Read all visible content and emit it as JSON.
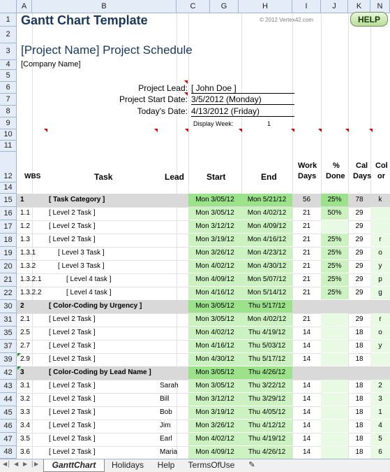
{
  "app": {
    "title": "Gantt Chart Template",
    "copyright": "© 2012 Vertex42.com",
    "help_label": "HELP"
  },
  "columns": [
    "A",
    "B",
    "C",
    "G",
    "H",
    "I",
    "J",
    "K",
    "N"
  ],
  "row_numbers": [
    "1",
    "2",
    "3",
    "4",
    "5",
    "6",
    "7",
    "8",
    "9",
    "10",
    "11",
    "12",
    "14",
    "15",
    "16",
    "17",
    "18",
    "19",
    "20",
    "21",
    "22",
    "30",
    "31",
    "35",
    "37",
    "39",
    "42",
    "43",
    "44",
    "45",
    "46",
    "47",
    "48"
  ],
  "project": {
    "name": "[Project Name] Project Schedule",
    "company": "[Company Name]",
    "lead_label": "Project Lead:",
    "lead_value": "[ John Doe ]",
    "start_label": "Project Start Date:",
    "start_value": "3/5/2012 (Monday)",
    "today_label": "Today's Date:",
    "today_value": "4/13/2012 (Friday)",
    "week_label": "Display Week:",
    "week_value": "1"
  },
  "headers": {
    "wbs": "WBS",
    "task": "Task",
    "lead": "Lead",
    "start": "Start",
    "end": "End",
    "work_days_1": "Work",
    "work_days_2": "Days",
    "done_1": "%",
    "done_2": "Done",
    "cal_days_1": "Cal",
    "cal_days_2": "Days",
    "color_1": "Col",
    "color_2": "or"
  },
  "tasks": [
    {
      "wbs": "1",
      "task": "[ Task Category ]",
      "lead": "",
      "start": "Mon 3/05/12",
      "end": "Mon 5/21/12",
      "work": "56",
      "done": "25%",
      "cal": "78",
      "color": "k",
      "type": "category"
    },
    {
      "wbs": "1.1",
      "task": "[ Level 2 Task ]",
      "lead": "",
      "start": "Mon 3/05/12",
      "end": "Mon 4/02/12",
      "work": "21",
      "done": "50%",
      "cal": "29",
      "color": "",
      "type": "task"
    },
    {
      "wbs": "1.2",
      "task": "[ Level 2 Task ]",
      "lead": "",
      "start": "Mon 3/12/12",
      "end": "Mon 4/09/12",
      "work": "21",
      "done": "",
      "cal": "29",
      "color": "",
      "type": "task"
    },
    {
      "wbs": "1.3",
      "task": "[ Level 2 Task ]",
      "lead": "",
      "start": "Mon 3/19/12",
      "end": "Mon 4/16/12",
      "work": "21",
      "done": "25%",
      "cal": "29",
      "color": "r",
      "type": "task"
    },
    {
      "wbs": "1.3.1",
      "task": "[ Level 3 Task ]",
      "lead": "",
      "start": "Mon 3/26/12",
      "end": "Mon 4/23/12",
      "work": "21",
      "done": "25%",
      "cal": "29",
      "color": "o",
      "type": "task3"
    },
    {
      "wbs": "1.3.2",
      "task": "[ Level 3 Task ]",
      "lead": "",
      "start": "Mon 4/02/12",
      "end": "Mon 4/30/12",
      "work": "21",
      "done": "25%",
      "cal": "29",
      "color": "y",
      "type": "task3"
    },
    {
      "wbs": "1.3.2.1",
      "task": "[ Level 4 task ]",
      "lead": "",
      "start": "Mon 4/09/12",
      "end": "Mon 5/07/12",
      "work": "21",
      "done": "25%",
      "cal": "29",
      "color": "p",
      "type": "task4"
    },
    {
      "wbs": "1.3.2.2",
      "task": "[ Level 4 task ]",
      "lead": "",
      "start": "Mon 4/16/12",
      "end": "Mon 5/14/12",
      "work": "21",
      "done": "25%",
      "cal": "29",
      "color": "g",
      "type": "task4"
    },
    {
      "wbs": "2",
      "task": "[ Color-Coding by Urgency ]",
      "lead": "",
      "start": "Mon 3/05/12",
      "end": "Thu 5/17/12",
      "work": "",
      "done": "",
      "cal": "",
      "color": "",
      "type": "category"
    },
    {
      "wbs": "2.1",
      "task": "[ Level 2 Task ]",
      "lead": "",
      "start": "Mon 3/05/12",
      "end": "Mon 4/02/12",
      "work": "21",
      "done": "",
      "cal": "29",
      "color": "r",
      "type": "task"
    },
    {
      "wbs": "2.5",
      "task": "[ Level 2 Task ]",
      "lead": "",
      "start": "Mon 4/02/12",
      "end": "Thu 4/19/12",
      "work": "14",
      "done": "",
      "cal": "18",
      "color": "o",
      "type": "task"
    },
    {
      "wbs": "2.7",
      "task": "[ Level 2 Task ]",
      "lead": "",
      "start": "Mon 4/16/12",
      "end": "Thu 5/03/12",
      "work": "14",
      "done": "",
      "cal": "18",
      "color": "y",
      "type": "task"
    },
    {
      "wbs": "2.9",
      "task": "[ Level 2 Task ]",
      "lead": "",
      "start": "Mon 4/30/12",
      "end": "Thu 5/17/12",
      "work": "14",
      "done": "",
      "cal": "18",
      "color": "",
      "type": "task"
    },
    {
      "wbs": "3",
      "task": "[ Color-Coding by Lead Name ]",
      "lead": "",
      "start": "Mon 3/05/12",
      "end": "Thu 4/26/12",
      "work": "",
      "done": "",
      "cal": "",
      "color": "",
      "type": "category"
    },
    {
      "wbs": "3.1",
      "task": "[ Level 2 Task ]",
      "lead": "Sarah",
      "start": "Mon 3/05/12",
      "end": "Thu 3/22/12",
      "work": "14",
      "done": "",
      "cal": "18",
      "color": "2",
      "type": "task"
    },
    {
      "wbs": "3.2",
      "task": "[ Level 2 Task ]",
      "lead": "Bill",
      "start": "Mon 3/12/12",
      "end": "Thu 3/29/12",
      "work": "14",
      "done": "",
      "cal": "18",
      "color": "3",
      "type": "task"
    },
    {
      "wbs": "3.3",
      "task": "[ Level 2 Task ]",
      "lead": "Bob",
      "start": "Mon 3/19/12",
      "end": "Thu 4/05/12",
      "work": "14",
      "done": "",
      "cal": "18",
      "color": "1",
      "type": "task"
    },
    {
      "wbs": "3.4",
      "task": "[ Level 2 Task ]",
      "lead": "Jim",
      "start": "Mon 3/26/12",
      "end": "Thu 4/12/12",
      "work": "14",
      "done": "",
      "cal": "18",
      "color": "4",
      "type": "task"
    },
    {
      "wbs": "3.5",
      "task": "[ Level 2 Task ]",
      "lead": "Earl",
      "start": "Mon 4/02/12",
      "end": "Thu 4/19/12",
      "work": "14",
      "done": "",
      "cal": "18",
      "color": "5",
      "type": "task"
    },
    {
      "wbs": "3.6",
      "task": "[ Level 2 Task ]",
      "lead": "Maria",
      "start": "Mon 4/09/12",
      "end": "Thu 4/26/12",
      "work": "14",
      "done": "",
      "cal": "18",
      "color": "6",
      "type": "task"
    }
  ],
  "sheet_tabs": [
    "GanttChart",
    "Holidays",
    "Help",
    "TermsOfUse"
  ],
  "colors": {
    "title": "#17375e",
    "green_cell": "#ccf2c1",
    "green_dark": "#9be28b",
    "light_green": "#e8f9e4",
    "category_bg": "#d9d9d9",
    "header_bg": "#e4ecf7",
    "corner_mark": "#d40000"
  }
}
